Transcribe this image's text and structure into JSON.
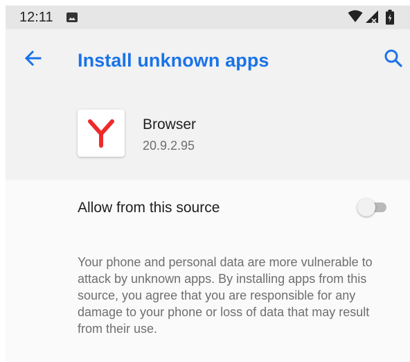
{
  "status_bar": {
    "time": "12:11"
  },
  "header": {
    "title": "Install unknown apps"
  },
  "app": {
    "name": "Browser",
    "version": "20.9.2.95",
    "icon": "yandex-y-logo"
  },
  "setting": {
    "label": "Allow from this source",
    "enabled": false
  },
  "warning": {
    "text": "Your phone and personal data are more vulnerable to attack by unknown apps. By installing apps from this source, you agree that you are responsible for any damage to your phone or loss of data that may result from their use."
  },
  "colors": {
    "accent": "#1a73e8",
    "logo_red": "#ee2a2a",
    "status_bar_bg": "#e6e6e6",
    "header_bg": "#f2f2f2",
    "body_bg": "#fafafa"
  },
  "icons": {
    "back": "arrow-back-icon",
    "search": "search-icon",
    "notification": "image-icon",
    "wifi": "wifi-icon",
    "signal": "signal-icon",
    "battery": "battery-icon"
  }
}
